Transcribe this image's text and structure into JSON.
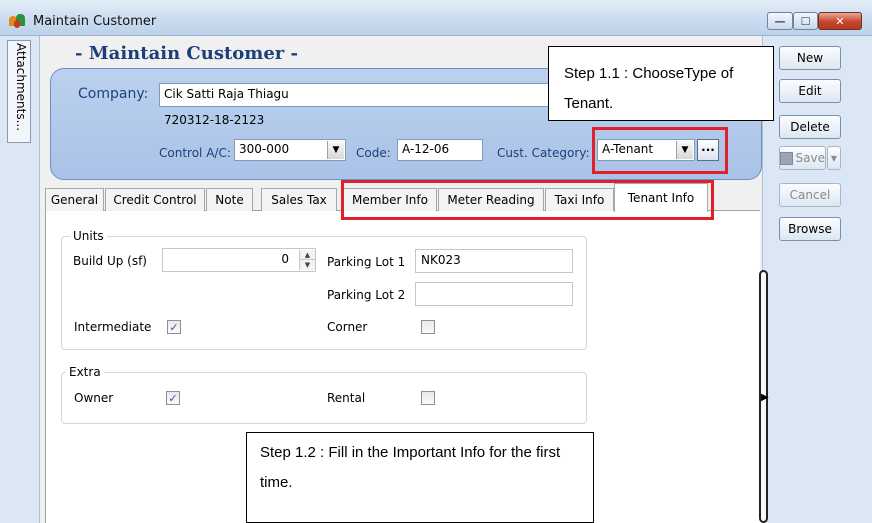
{
  "window": {
    "title": "Maintain Customer",
    "min_glyph": "—",
    "max_glyph": "☐",
    "close_glyph": "✕"
  },
  "left_strip": {
    "attachments_label": "Attachments..."
  },
  "header": {
    "form_title": "- Maintain Customer -",
    "company_label": "Company:",
    "company_value": "Cik Satti Raja Thiagu",
    "reg_no": "720312-18-2123",
    "control_ac_label": "Control A/C:",
    "control_ac_value": "300-000",
    "code_label": "Code:",
    "code_value": "A-12-06",
    "cust_category_label": "Cust. Category:",
    "cust_category_value": "A-Tenant",
    "more_glyph": "···"
  },
  "tabs": [
    {
      "label": "General"
    },
    {
      "label": "Credit Control"
    },
    {
      "label": "Note"
    },
    {
      "label": "Sales Tax"
    },
    {
      "label": "Member Info"
    },
    {
      "label": "Meter Reading"
    },
    {
      "label": "Taxi Info"
    },
    {
      "label": "Tenant Info",
      "active": true
    }
  ],
  "tenant_info": {
    "units_legend": "Units",
    "build_up_label": "Build Up (sf)",
    "build_up_value": "0",
    "parking_lot_1_label": "Parking Lot 1",
    "parking_lot_1_value": "NK023",
    "parking_lot_2_label": "Parking Lot 2",
    "parking_lot_2_value": "",
    "intermediate_label": "Intermediate",
    "intermediate_checked": true,
    "corner_label": "Corner",
    "corner_checked": false,
    "extra_legend": "Extra",
    "owner_label": "Owner",
    "owner_checked": true,
    "rental_label": "Rental",
    "rental_checked": false,
    "check_glyph": "✓"
  },
  "toolbar": {
    "new_label": "New",
    "edit_label": "Edit",
    "delete_label": "Delete",
    "save_label": "Save",
    "cancel_label": "Cancel",
    "browse_label": "Browse",
    "save_enabled": false,
    "cancel_enabled": false
  },
  "callouts": {
    "step_1_1": "Step 1.1 : ChooseType of Tenant.",
    "step_1_2": "Step 1.2 : Fill in the Important Info for the first time."
  },
  "colors": {
    "header_bg": "#bcd1ee",
    "title_blue": "#1a3f7a",
    "highlight_red": "#e0202a"
  }
}
